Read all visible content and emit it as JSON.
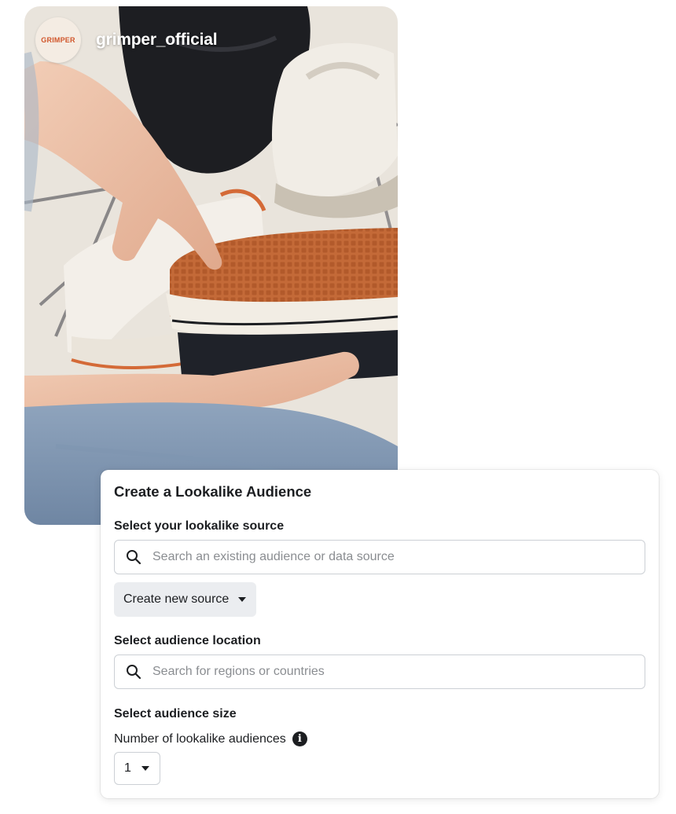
{
  "post": {
    "avatar_text": "GRIMPER",
    "username": "grimper_official",
    "photo_description_icon": "sneakers-photo"
  },
  "dialog": {
    "title": "Create a Lookalike Audience",
    "source": {
      "label": "Select your lookalike source",
      "search_placeholder": "Search an existing audience or data source",
      "search_value": "",
      "create_button_label": "Create new source"
    },
    "location": {
      "label": "Select audience location",
      "search_placeholder": "Search for regions or countries",
      "search_value": ""
    },
    "size": {
      "label": "Select audience size",
      "count_label": "Number of lookalike audiences",
      "count_value": "1"
    }
  },
  "colors": {
    "brand_orange": "#d1562b",
    "text_primary": "#1c1e21",
    "placeholder": "#8a8d91",
    "border": "#ccd0d5",
    "button_bg": "#ebedf0"
  }
}
